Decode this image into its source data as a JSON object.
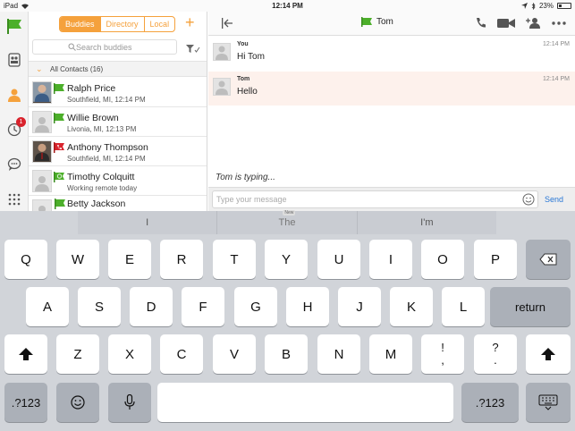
{
  "status_bar": {
    "device": "iPad",
    "time": "12:14 PM",
    "battery": "23%"
  },
  "rail": {
    "items": [
      "flag-logo",
      "contacts-book",
      "buddies",
      "history",
      "chat",
      "dialpad"
    ],
    "history_badge": "1"
  },
  "buddies": {
    "tabs": [
      "Buddies",
      "Directory",
      "Local"
    ],
    "active_tab": "Buddies",
    "search_placeholder": "Search buddies",
    "group_label": "All Contacts (16)",
    "contacts": [
      {
        "name": "Ralph Price",
        "sub": "Southfield, MI, 12:14 PM",
        "presence": "available",
        "photo": true
      },
      {
        "name": "Willie Brown",
        "sub": "Livonia, MI, 12:13 PM",
        "presence": "available",
        "photo": false
      },
      {
        "name": "Anthony Thompson",
        "sub": "Southfield, MI, 12:14 PM",
        "presence": "on-phone",
        "photo": true
      },
      {
        "name": "Timothy Colquitt",
        "sub": "Working remote today",
        "presence": "away",
        "photo": false
      },
      {
        "name": "Betty Jackson",
        "sub": "",
        "presence": "available",
        "photo": false
      }
    ]
  },
  "chat": {
    "title": "Tom",
    "messages": [
      {
        "from": "You",
        "text": "Hi Tom",
        "time": "12:14 PM"
      },
      {
        "from": "Tom",
        "text": "Hello",
        "time": "12:14 PM"
      }
    ],
    "typing": "Tom is typing...",
    "input_placeholder": "Type your message",
    "send_label": "Send"
  },
  "keyboard": {
    "predictions": [
      "I",
      "The",
      "I'm"
    ],
    "prediction_tag": "New",
    "row1": [
      "Q",
      "W",
      "E",
      "R",
      "T",
      "Y",
      "U",
      "I",
      "O",
      "P"
    ],
    "row2": [
      "A",
      "S",
      "D",
      "F",
      "G",
      "H",
      "J",
      "K",
      "L"
    ],
    "return_label": "return",
    "row3": [
      "Z",
      "X",
      "C",
      "V",
      "B",
      "N",
      "M",
      "!\n,",
      "?\n."
    ],
    "numbers_label": ".?123"
  },
  "colors": {
    "accent": "#f5a13c",
    "presence_green": "#4caf2a",
    "send_blue": "#2a78d6",
    "badge_red": "#d9232d"
  }
}
